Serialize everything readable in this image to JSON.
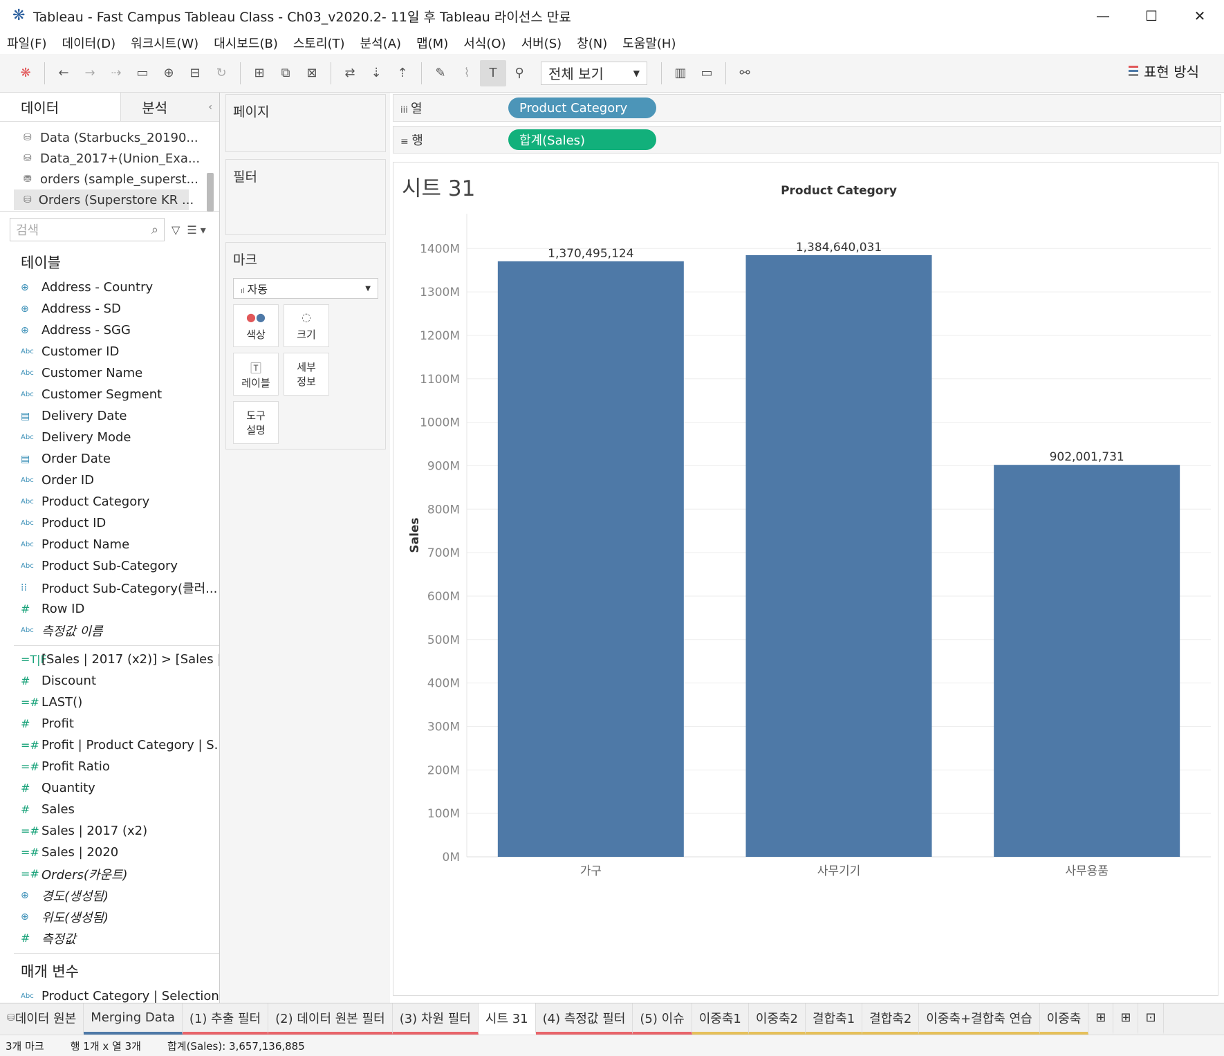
{
  "window": {
    "title": "Tableau - Fast Campus Tableau Class - Ch03_v2020.2- 11일 후 Tableau 라이선스 만료",
    "minimize": "—",
    "maximize": "☐",
    "close": "✕"
  },
  "menu": [
    "파일(F)",
    "데이터(D)",
    "워크시트(W)",
    "대시보드(B)",
    "스토리(T)",
    "분석(A)",
    "맵(M)",
    "서식(O)",
    "서버(S)",
    "창(N)",
    "도움말(H)"
  ],
  "toolbar": {
    "view_select": "전체 보기",
    "show_me": "표현 방식"
  },
  "left_panel": {
    "tab_data": "데이터",
    "tab_analysis": "분석",
    "data_sources": [
      "Data (Starbucks_20190...",
      "Data_2017+(Union_Exa...",
      "orders (sample_superst...",
      "Orders (Superstore KR ..."
    ],
    "search_placeholder": "검색",
    "tables_header": "테이블",
    "dimensions": [
      {
        "type": "geo",
        "name": "Address - Country"
      },
      {
        "type": "geo",
        "name": "Address - SD"
      },
      {
        "type": "geo",
        "name": "Address - SGG"
      },
      {
        "type": "Abc",
        "name": "Customer ID"
      },
      {
        "type": "Abc",
        "name": "Customer Name"
      },
      {
        "type": "Abc",
        "name": "Customer Segment"
      },
      {
        "type": "date",
        "name": "Delivery Date"
      },
      {
        "type": "Abc",
        "name": "Delivery Mode"
      },
      {
        "type": "date",
        "name": "Order Date"
      },
      {
        "type": "Abc",
        "name": "Order ID"
      },
      {
        "type": "Abc",
        "name": "Product Category"
      },
      {
        "type": "Abc",
        "name": "Product ID"
      },
      {
        "type": "Abc",
        "name": "Product Name"
      },
      {
        "type": "Abc",
        "name": "Product Sub-Category"
      },
      {
        "type": "cluster",
        "name": "Product Sub-Category(클러..."
      },
      {
        "type": "#",
        "name": "Row ID"
      },
      {
        "type": "Abc",
        "name": "측정값 이름"
      }
    ],
    "measures": [
      {
        "type": "T|F",
        "name": "[Sales | 2017 (x2)] > [Sales |..."
      },
      {
        "type": "#",
        "name": "Discount"
      },
      {
        "type": "=#",
        "name": "LAST()"
      },
      {
        "type": "#",
        "name": "Profit"
      },
      {
        "type": "=#",
        "name": "Profit | Product Category | S..."
      },
      {
        "type": "=#",
        "name": "Profit Ratio"
      },
      {
        "type": "#",
        "name": "Quantity"
      },
      {
        "type": "#",
        "name": "Sales"
      },
      {
        "type": "=#",
        "name": "Sales | 2017 (x2)"
      },
      {
        "type": "=#",
        "name": "Sales | 2020"
      },
      {
        "type": "=#",
        "name": "Orders(카운트)"
      },
      {
        "type": "geo",
        "name": "경도(생성됨)"
      },
      {
        "type": "geo",
        "name": "위도(생성됨)"
      },
      {
        "type": "#",
        "name": "측정값"
      }
    ],
    "params_header": "매개 변수",
    "parameters": [
      {
        "type": "Abc",
        "name": "Product Category | Selection"
      }
    ]
  },
  "cards": {
    "pages": "페이지",
    "filters": "필터",
    "marks": "마크",
    "mark_type": "자동",
    "mark_buttons": [
      "색상",
      "크기",
      "레이블",
      "세부\n정보",
      "도구\n설명"
    ]
  },
  "shelves": {
    "columns_label": "열",
    "columns_pill": "Product Category",
    "rows_label": "행",
    "rows_pill": "합계(Sales)"
  },
  "sheet_title": "시트 31",
  "chart_data": {
    "type": "bar",
    "title": "Product Category",
    "xlabel": "",
    "ylabel": "Sales",
    "categories": [
      "가구",
      "사무기기",
      "사무용품"
    ],
    "values": [
      1370495124,
      1384640031,
      902001731
    ],
    "value_labels": [
      "1,370,495,124",
      "1,384,640,031",
      "902,001,731"
    ],
    "ylim": [
      0,
      1480000000
    ],
    "yticks": [
      0,
      100000000,
      200000000,
      300000000,
      400000000,
      500000000,
      600000000,
      700000000,
      800000000,
      900000000,
      1000000000,
      1100000000,
      1200000000,
      1300000000,
      1400000000
    ],
    "ytick_labels": [
      "0M",
      "100M",
      "200M",
      "300M",
      "400M",
      "500M",
      "600M",
      "700M",
      "800M",
      "900M",
      "1000M",
      "1100M",
      "1200M",
      "1300M",
      "1400M"
    ],
    "bar_color": "#4e79a7",
    "grid": true
  },
  "bottom_tabs": [
    {
      "label": "데이터 원본",
      "style": "plain"
    },
    {
      "label": "Merging Data",
      "style": "blu"
    },
    {
      "label": "(1) 추출 필터",
      "style": "red"
    },
    {
      "label": "(2) 데이터 원본 필터",
      "style": "red"
    },
    {
      "label": "(3) 차원 필터",
      "style": "red"
    },
    {
      "label": "시트 31",
      "style": "act"
    },
    {
      "label": "(4) 측정값 필터",
      "style": "red"
    },
    {
      "label": "(5) 이슈",
      "style": "red"
    },
    {
      "label": "이중축1",
      "style": "yel"
    },
    {
      "label": "이중축2",
      "style": "yel"
    },
    {
      "label": "결합축1",
      "style": "yel"
    },
    {
      "label": "결합축2",
      "style": "yel"
    },
    {
      "label": "이중축+결합축 연습",
      "style": "yel"
    },
    {
      "label": "이중축",
      "style": "yel"
    }
  ],
  "status": {
    "marks": "3개 마크",
    "rows_cols": "행 1개 x 열 3개",
    "sum": "합계(Sales): 3,657,136,885"
  }
}
